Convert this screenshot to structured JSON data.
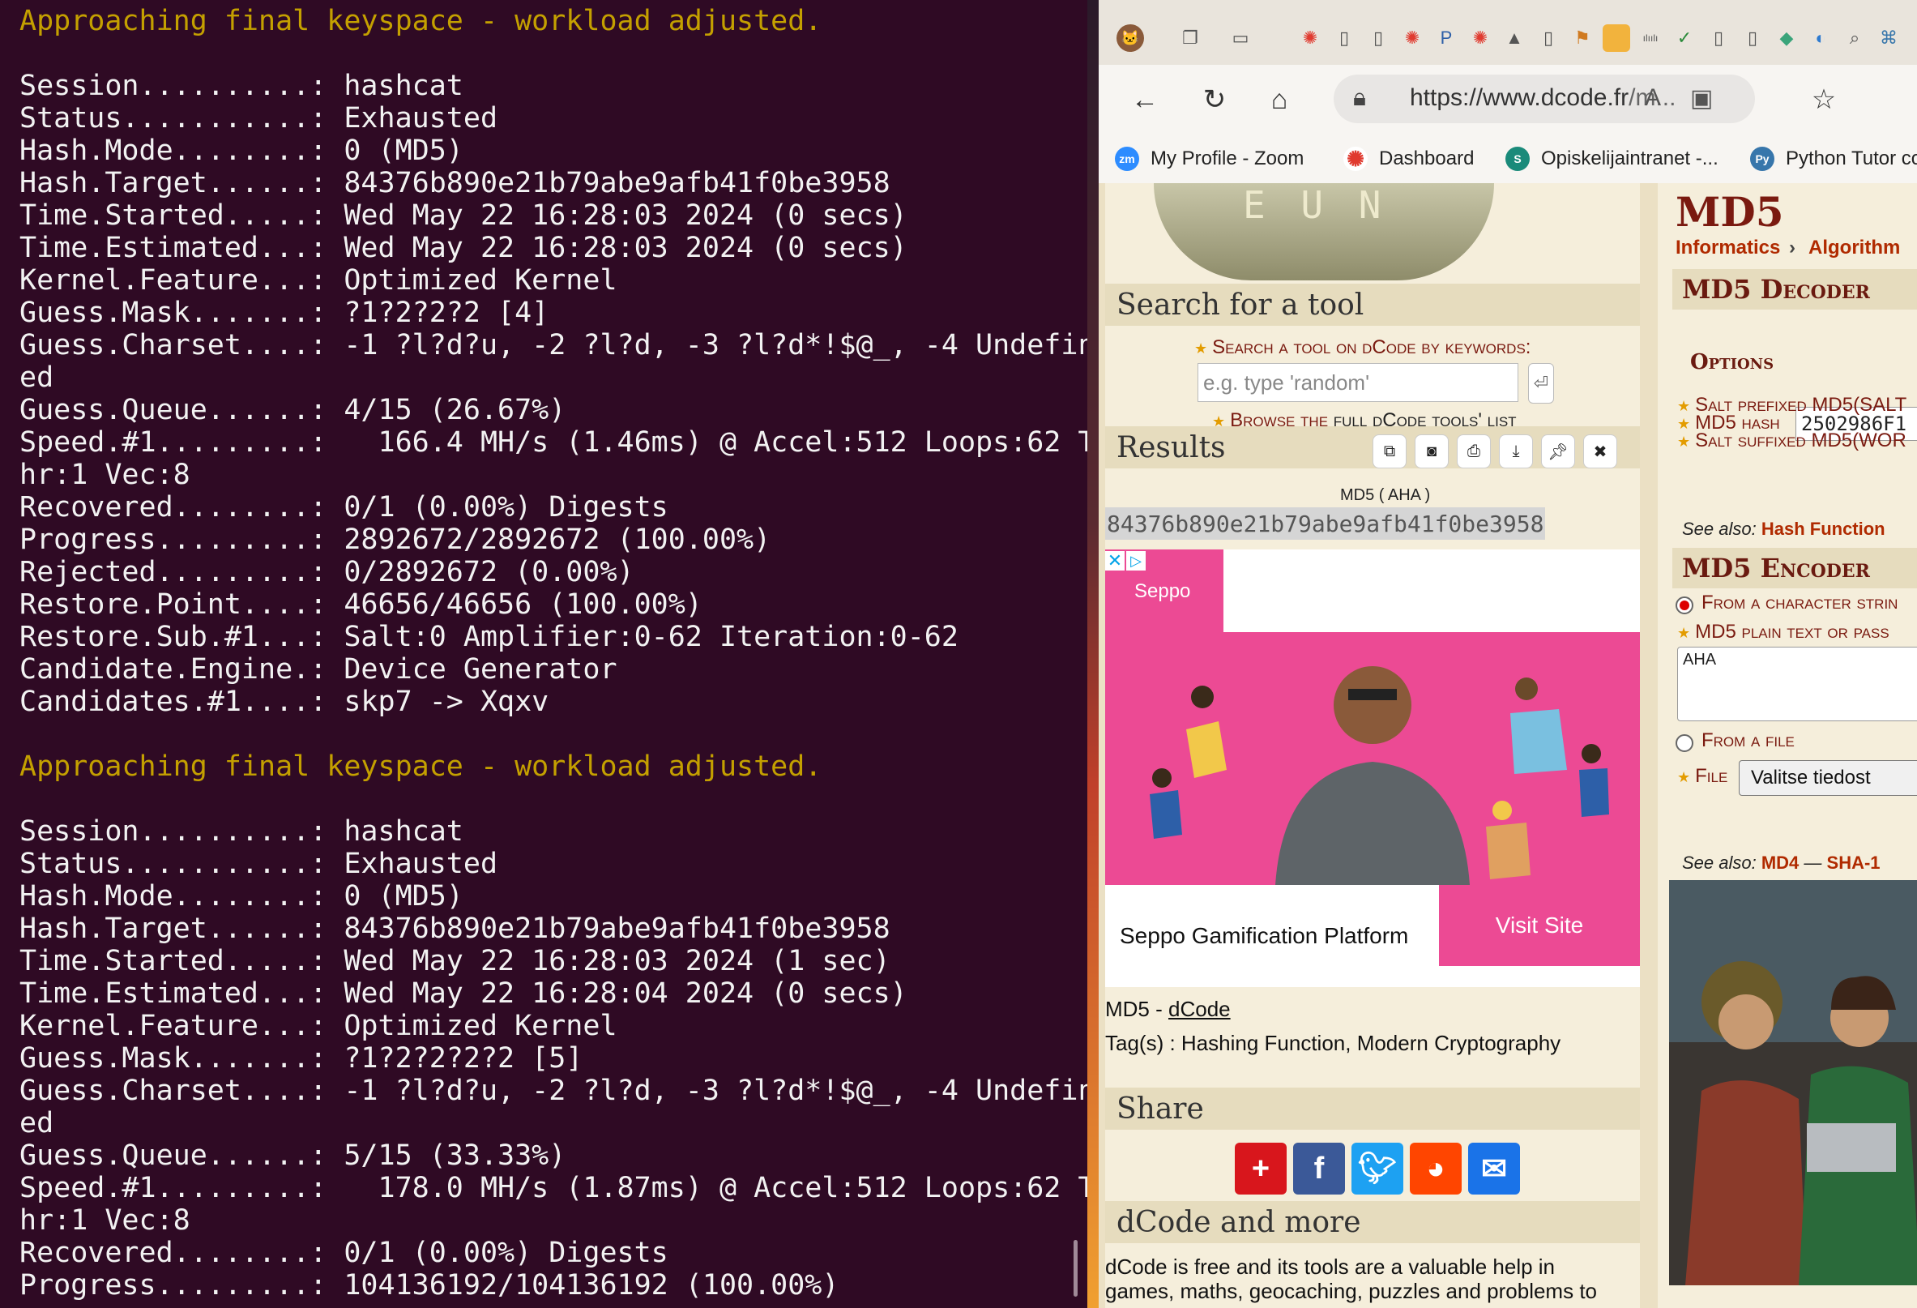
{
  "terminal": {
    "lines": [
      {
        "text": "Approaching final keyspace - workload adjusted.",
        "kind": "warn"
      },
      {
        "text": "",
        "kind": "blank"
      },
      {
        "text": "Session..........: hashcat",
        "kind": "normal"
      },
      {
        "text": "Status...........: Exhausted",
        "kind": "normal"
      },
      {
        "text": "Hash.Mode........: 0 (MD5)",
        "kind": "normal"
      },
      {
        "text": "Hash.Target......: 84376b890e21b79abe9afb41f0be3958",
        "kind": "normal"
      },
      {
        "text": "Time.Started.....: Wed May 22 16:28:03 2024 (0 secs)",
        "kind": "normal"
      },
      {
        "text": "Time.Estimated...: Wed May 22 16:28:03 2024 (0 secs)",
        "kind": "normal"
      },
      {
        "text": "Kernel.Feature...: Optimized Kernel",
        "kind": "normal"
      },
      {
        "text": "Guess.Mask.......: ?1?2?2?2 [4]",
        "kind": "normal"
      },
      {
        "text": "Guess.Charset....: -1 ?l?d?u, -2 ?l?d, -3 ?l?d*!$@_, -4 Undefin",
        "kind": "normal"
      },
      {
        "text": "ed",
        "kind": "normal"
      },
      {
        "text": "Guess.Queue......: 4/15 (26.67%)",
        "kind": "normal"
      },
      {
        "text": "Speed.#1.........:   166.4 MH/s (1.46ms) @ Accel:512 Loops:62 T",
        "kind": "normal"
      },
      {
        "text": "hr:1 Vec:8",
        "kind": "normal"
      },
      {
        "text": "Recovered........: 0/1 (0.00%) Digests",
        "kind": "normal"
      },
      {
        "text": "Progress.........: 2892672/2892672 (100.00%)",
        "kind": "normal"
      },
      {
        "text": "Rejected.........: 0/2892672 (0.00%)",
        "kind": "normal"
      },
      {
        "text": "Restore.Point....: 46656/46656 (100.00%)",
        "kind": "normal"
      },
      {
        "text": "Restore.Sub.#1...: Salt:0 Amplifier:0-62 Iteration:0-62",
        "kind": "normal"
      },
      {
        "text": "Candidate.Engine.: Device Generator",
        "kind": "normal"
      },
      {
        "text": "Candidates.#1....: skp7 -> Xqxv",
        "kind": "normal"
      },
      {
        "text": "",
        "kind": "blank"
      },
      {
        "text": "Approaching final keyspace - workload adjusted.",
        "kind": "warn"
      },
      {
        "text": "",
        "kind": "blank"
      },
      {
        "text": "Session..........: hashcat",
        "kind": "normal"
      },
      {
        "text": "Status...........: Exhausted",
        "kind": "normal"
      },
      {
        "text": "Hash.Mode........: 0 (MD5)",
        "kind": "normal"
      },
      {
        "text": "Hash.Target......: 84376b890e21b79abe9afb41f0be3958",
        "kind": "normal"
      },
      {
        "text": "Time.Started.....: Wed May 22 16:28:03 2024 (1 sec)",
        "kind": "normal"
      },
      {
        "text": "Time.Estimated...: Wed May 22 16:28:04 2024 (0 secs)",
        "kind": "normal"
      },
      {
        "text": "Kernel.Feature...: Optimized Kernel",
        "kind": "normal"
      },
      {
        "text": "Guess.Mask.......: ?1?2?2?2?2 [5]",
        "kind": "normal"
      },
      {
        "text": "Guess.Charset....: -1 ?l?d?u, -2 ?l?d, -3 ?l?d*!$@_, -4 Undefin",
        "kind": "normal"
      },
      {
        "text": "ed",
        "kind": "normal"
      },
      {
        "text": "Guess.Queue......: 5/15 (33.33%)",
        "kind": "normal"
      },
      {
        "text": "Speed.#1.........:   178.0 MH/s (1.87ms) @ Accel:512 Loops:62 T",
        "kind": "normal"
      },
      {
        "text": "hr:1 Vec:8",
        "kind": "normal"
      },
      {
        "text": "Recovered........: 0/1 (0.00%) Digests",
        "kind": "normal"
      },
      {
        "text": "Progress.........: 104136192/104136192 (100.00%)",
        "kind": "normal"
      }
    ]
  },
  "browser": {
    "url_main": "https://www.dcode.fr",
    "url_rest": "/m...",
    "favorites": [
      {
        "label": "My Profile - Zoom",
        "icon": "zoom-icon",
        "color": "#2d8cff",
        "glyph": "zm"
      },
      {
        "label": "Dashboard",
        "icon": "dashboard-icon",
        "color": "#e03a2f",
        "glyph": "✺"
      },
      {
        "label": "Opiskelijaintranet -...",
        "icon": "intranet-icon",
        "color": "#1a8a7a",
        "glyph": "S"
      },
      {
        "label": "Python Tutor co",
        "icon": "python-icon",
        "color": "#3776ab",
        "glyph": "Py"
      }
    ]
  },
  "dcode": {
    "logo_letters": "E U N",
    "search_header": "Search for a tool",
    "search_prompt": "Search a tool on dCode by keywords:",
    "search_placeholder": "e.g. type 'random'",
    "browse_prefix": "Browse the ",
    "browse_link": "full dCode tools' list",
    "results_header": "Results",
    "result_label": "MD5 ( AHA )",
    "result_hash": "84376b890e21b79abe9afb41f0be3958",
    "ad": {
      "brand": "Seppo",
      "caption": "Seppo Gamification Platform",
      "visit": "Visit Site",
      "close": "✕",
      "choice": "▷"
    },
    "page_title_prefix": "MD5 - ",
    "page_title_link": "dCode",
    "tags": "Tag(s) : Hashing Function, Modern Cryptography",
    "share_header": "Share",
    "more_header": "dCode and more",
    "more_text_1": "dCode is free and its tools are a valuable help in",
    "more_text_2": "games, maths, geocaching, puzzles and problems to"
  },
  "sidebar": {
    "title": "MD5",
    "crumb_1": "Informatics",
    "crumb_sep": "›",
    "crumb_2": "Algorithm",
    "decoder_header": "MD5 Decoder",
    "md5_hash_label": "MD5 hash",
    "md5_hash_value": "2502986F1",
    "options_header": "Options",
    "salt_prefixed": "Salt prefixed MD5(SALT",
    "salt_suffixed": "Salt suffixed MD5(WOR",
    "see_also_1_prefix": "See also: ",
    "see_also_1_link": "Hash Function",
    "encoder_header": "MD5 Encoder",
    "from_string": "From a character strin",
    "plain_text_label": "MD5 plain text or pass",
    "plain_text_value": "AHA",
    "from_file": "From a file",
    "file_label": "File",
    "file_button": "Valitse tiedost",
    "see_also_2_prefix": "See also: ",
    "see_also_2_link_1": "MD4",
    "see_also_2_sep": " — ",
    "see_also_2_link_2": "SHA-1"
  }
}
